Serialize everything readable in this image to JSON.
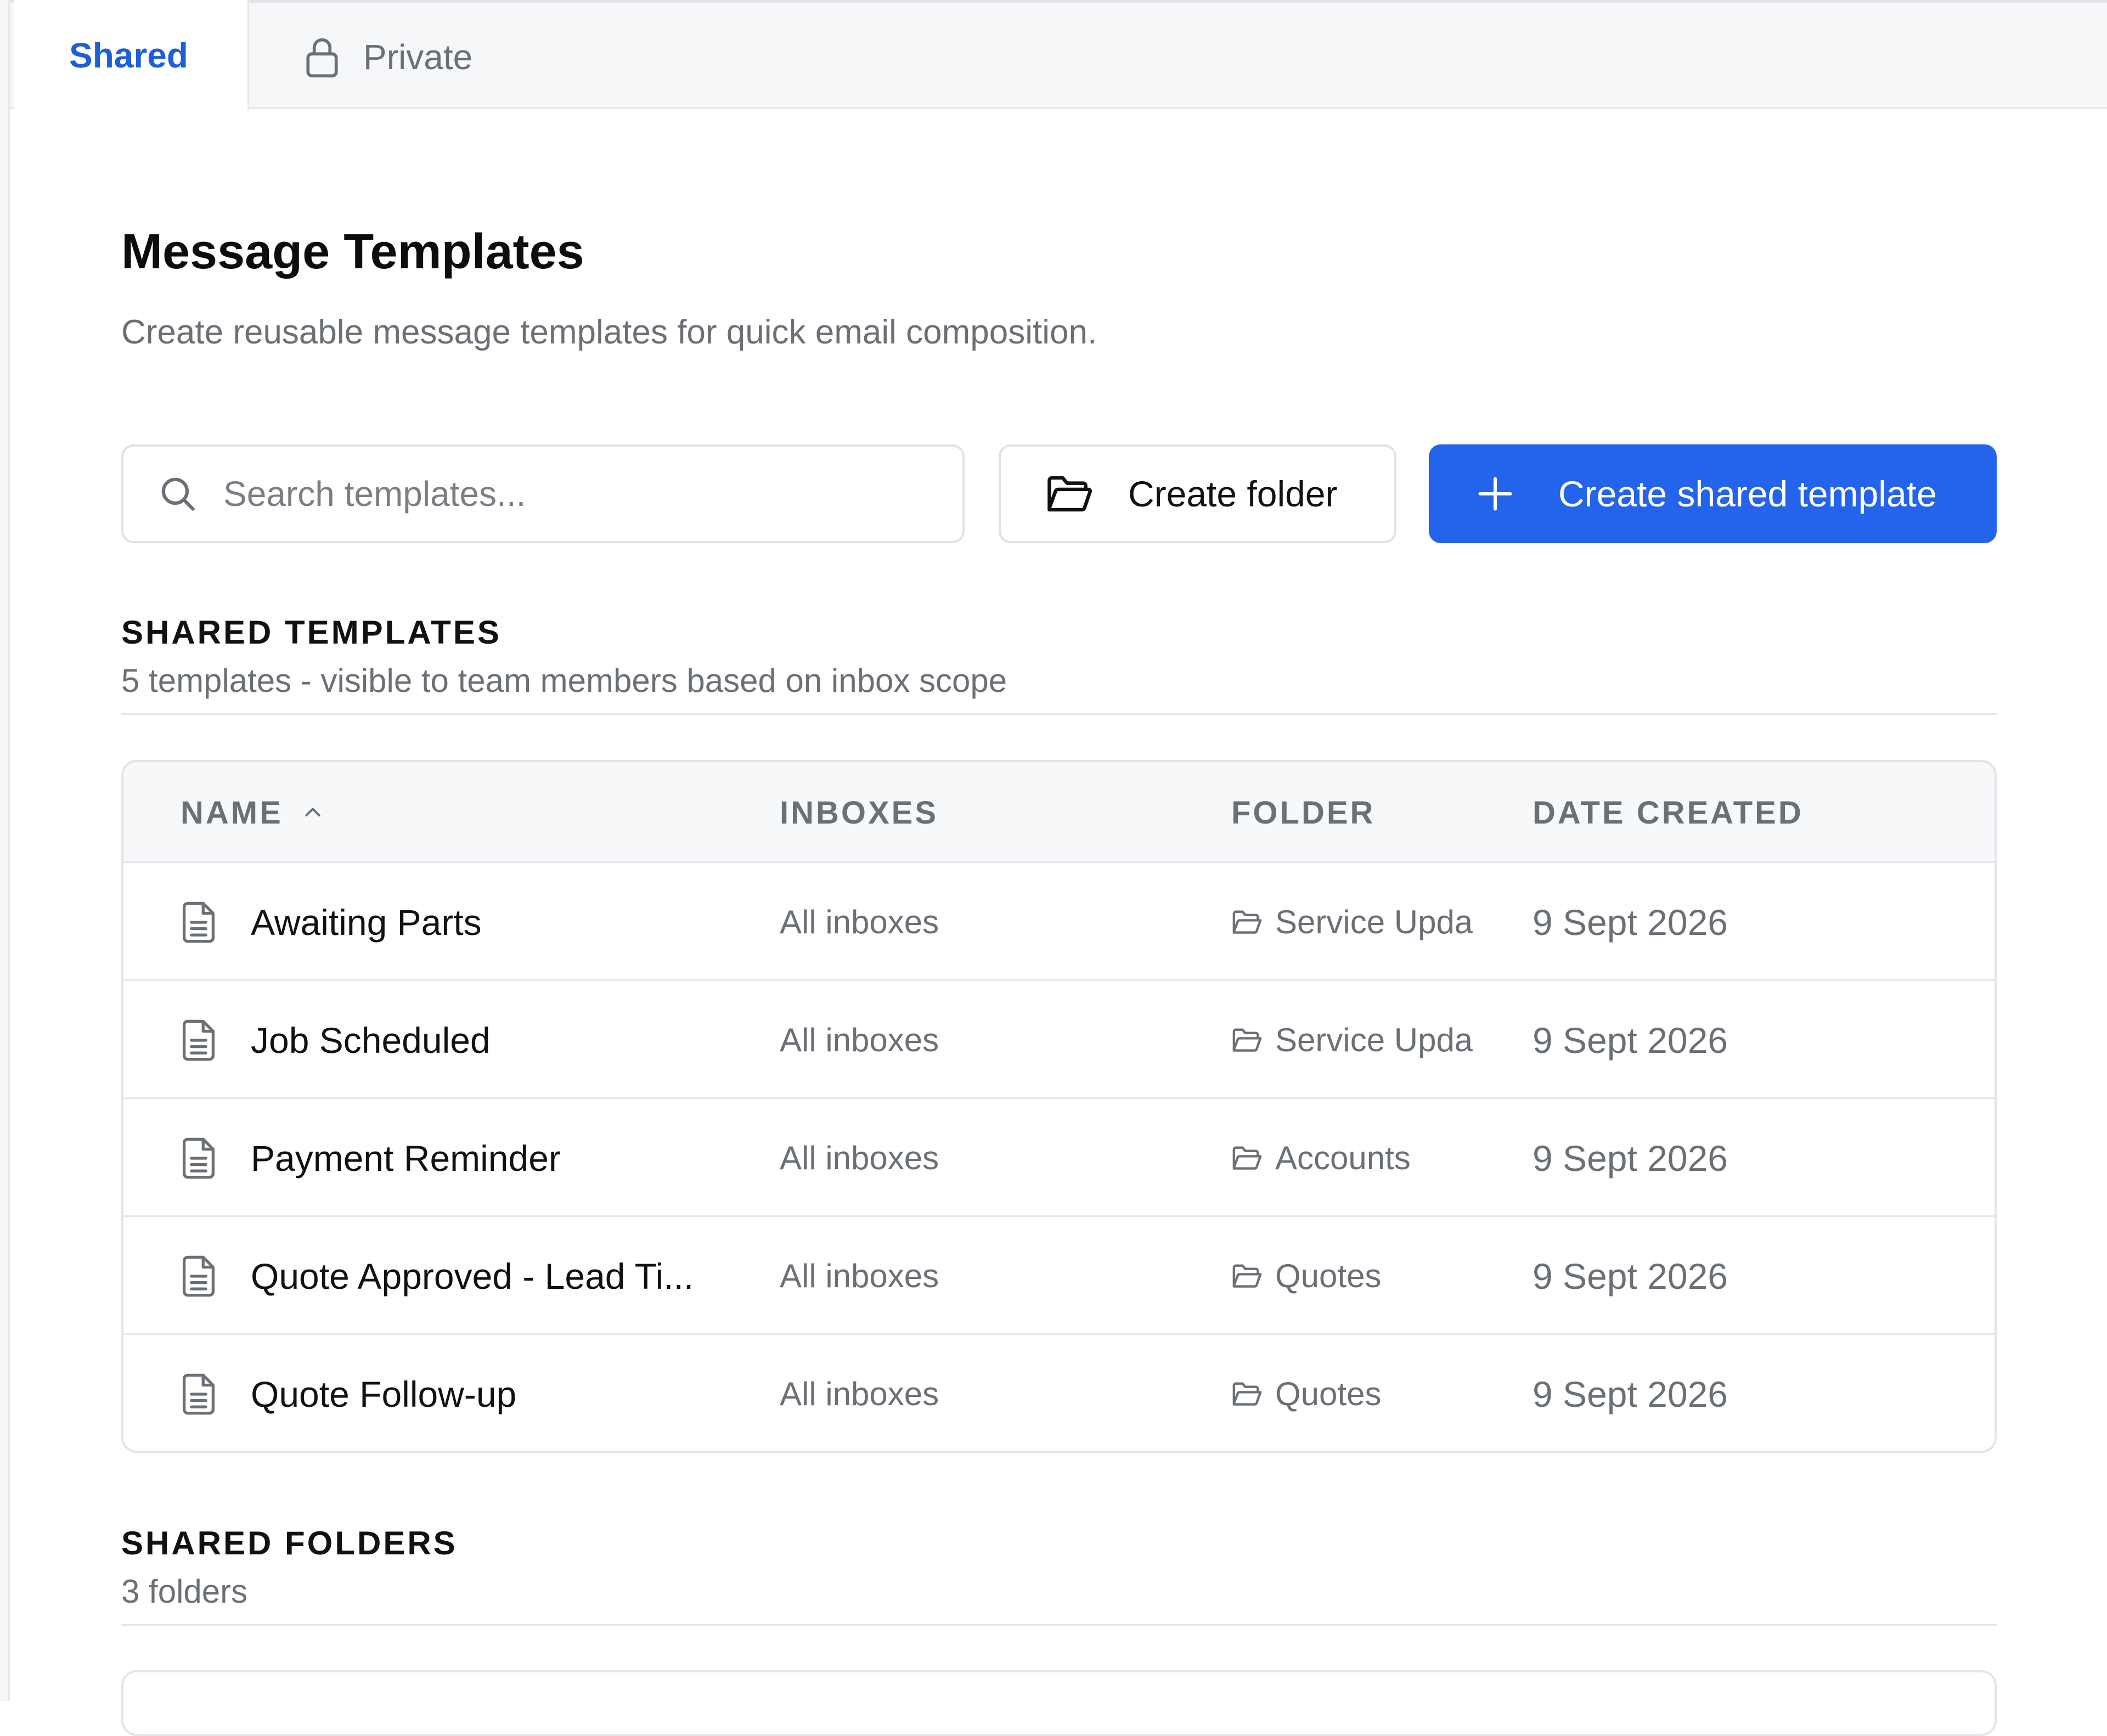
{
  "tabs": [
    {
      "label": "Shared",
      "active": true
    },
    {
      "label": "Private",
      "active": false,
      "icon": "lock-icon"
    }
  ],
  "header": {
    "title": "Message Templates",
    "subtitle": "Create reusable message templates for quick email composition."
  },
  "toolbar": {
    "search_placeholder": "Search templates...",
    "search_value": "",
    "create_folder_label": "Create folder",
    "create_template_label": "Create shared template"
  },
  "shared_templates": {
    "title": "SHARED TEMPLATES",
    "subtitle": "5 templates - visible to team members based on inbox scope",
    "columns": {
      "name": "NAME",
      "inboxes": "INBOXES",
      "folder": "FOLDER",
      "date_created": "DATE CREATED"
    },
    "sort": {
      "column": "name",
      "direction": "ascending"
    },
    "rows": [
      {
        "name": "Awaiting Parts",
        "inboxes": "All inboxes",
        "folder": "Service Upda",
        "date": "9 Sept 2026"
      },
      {
        "name": "Job Scheduled",
        "inboxes": "All inboxes",
        "folder": "Service Upda",
        "date": "9 Sept 2026"
      },
      {
        "name": "Payment Reminder",
        "inboxes": "All inboxes",
        "folder": "Accounts",
        "date": "9 Sept 2026"
      },
      {
        "name": "Quote Approved - Lead Ti...",
        "inboxes": "All inboxes",
        "folder": "Quotes",
        "date": "9 Sept 2026"
      },
      {
        "name": "Quote Follow-up",
        "inboxes": "All inboxes",
        "folder": "Quotes",
        "date": "9 Sept 2026"
      }
    ]
  },
  "shared_folders": {
    "title": "SHARED FOLDERS",
    "subtitle": "3 folders"
  },
  "colors": {
    "accent": "#2463eb",
    "active_tab_text": "#1d5fd6",
    "muted_text": "#6b6f76",
    "border": "#e3e5e9"
  }
}
